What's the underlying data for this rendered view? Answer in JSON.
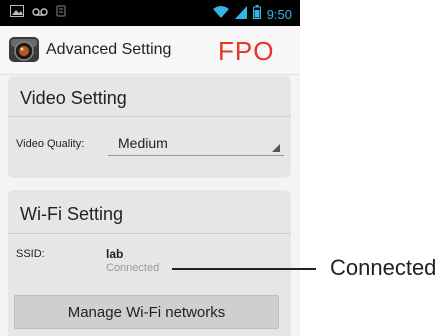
{
  "status_bar": {
    "time": "9:50",
    "icons_left": [
      "image-icon",
      "voicemail-icon",
      "notification-icon"
    ],
    "icons_right": [
      "wifi-icon",
      "signal-icon",
      "battery-icon"
    ],
    "accent_color": "#33b5e5"
  },
  "action_bar": {
    "title": "Advanced Setting",
    "app_icon": "camera-icon"
  },
  "fpo_label": "FPO",
  "video_setting": {
    "title": "Video Setting",
    "quality_label": "Video Quality:",
    "quality_value": "Medium"
  },
  "wifi_setting": {
    "title": "Wi-Fi Setting",
    "ssid_label": "SSID:",
    "ssid_value": "lab",
    "ssid_status": "Connected",
    "manage_button": "Manage Wi-Fi networks"
  },
  "callout": {
    "text": "Connected"
  }
}
